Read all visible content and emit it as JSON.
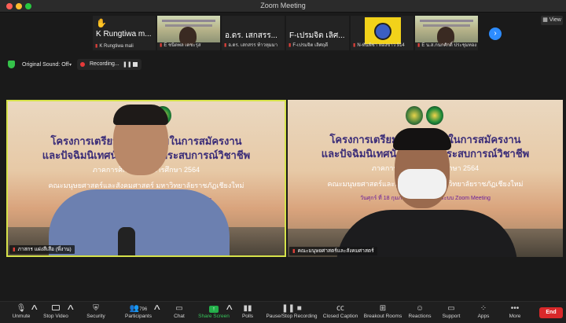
{
  "window": {
    "title": "Zoom Meeting"
  },
  "view_button": "View",
  "gallery": [
    {
      "big": "K  Rungtiwa m...",
      "name": "K  Rungtiwa mali",
      "hand": true,
      "type": "name"
    },
    {
      "big": "",
      "name": "E ชนิดพล เตชะรุส",
      "type": "video"
    },
    {
      "big": "อ.ดร. เสกสรร...",
      "name": "อ.ดร. เสกสรร ท้าวหุมมา",
      "type": "name"
    },
    {
      "big": "F-เปรมจิต เลิศ...",
      "name": "F-เปรมจิต เลิศฤดี",
      "type": "name"
    },
    {
      "big": "",
      "name": "N-ทันพิชา ทองขาว 914",
      "type": "yellow"
    },
    {
      "big": "",
      "name": "E น.ส.กนกศักดิ์ ประชุมทอง",
      "type": "video"
    }
  ],
  "recording": {
    "original_sound": "Original Sound: Off",
    "recording_label": "Recording..."
  },
  "slide": {
    "line1": "โครงการเตรียมความพร้อมในการสมัครงาน",
    "line2": "และปัจฉิมนิเทศนักศึกษาฝึกประสบการณ์วิชาชีพ",
    "line3": "ภาคการศึกษาที่ 2 ปีการศึกษา 2564",
    "line4": "คณะมนุษยศาสตร์และสังคมศาสตร์ มหาวิทยาลัยราชภัฏเชียงใหม่",
    "line5": "วันศุกร์ ที่ 18 กุมภาพันธ์ 2565 ผ่านระบบ Zoom Meeting"
  },
  "panes": [
    {
      "name": "ภาสกร แฝงสีเสือ (พี่งาน)"
    },
    {
      "name": "คณะมนุษยศาสตร์และสังคมศาสตร์"
    }
  ],
  "toolbar": {
    "unmute": "Unmute",
    "stop_video": "Stop Video",
    "security": "Security",
    "participants": "Participants",
    "participants_count": "796",
    "chat": "Chat",
    "share_screen": "Share Screen",
    "polls": "Polls",
    "pause_stop_recording": "Pause/Stop Recording",
    "closed_caption": "Closed Caption",
    "breakout_rooms": "Breakout Rooms",
    "reactions": "Reactions",
    "support": "Support",
    "apps": "Apps",
    "more": "More",
    "end": "End"
  },
  "colors": {
    "accent": "#2d8cff",
    "share": "#23b04a",
    "end": "#d8282a",
    "speaker_border": "#d6e24a"
  }
}
